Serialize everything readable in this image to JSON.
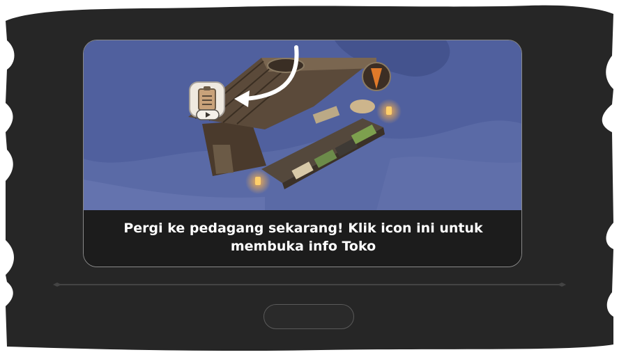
{
  "tutorial": {
    "message": "Pergi ke pedagang sekarang! Klik icon ini untuk membuka info Toko",
    "shop_icon": "clipboard-list-icon",
    "shop_icon_badge": "play-arrow-icon",
    "pointer": "curved-arrow-icon",
    "sign": "carrot-sign-icon"
  },
  "continue_button": {
    "label": ""
  },
  "colors": {
    "board": "#262626",
    "panel": "#1c1c1c",
    "snow": "#5a6aa6",
    "lantern": "#ffb44a",
    "border": "#8a8a8a"
  }
}
